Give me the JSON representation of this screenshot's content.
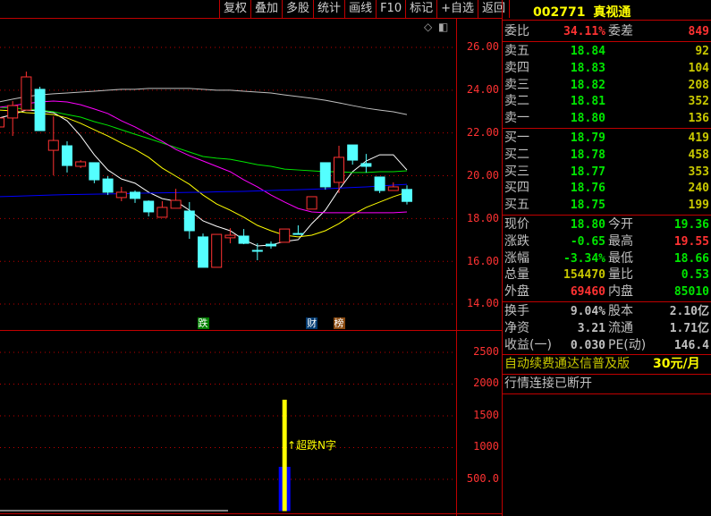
{
  "toolbar": {
    "buttons": [
      "复权",
      "叠加",
      "多股",
      "统计",
      "画线",
      "F10",
      "标记",
      "+自选",
      "返回"
    ]
  },
  "icons": {
    "diamond": "◇",
    "toggle": "◧"
  },
  "quote": {
    "code": "002771",
    "name": "真视通",
    "weibi": {
      "label": "委比",
      "value": "34.11%",
      "label2": "委差",
      "value2": "849",
      "color": "#ff3232",
      "color2": "#ff3232"
    },
    "asks": [
      {
        "label": "卖五",
        "price": "18.84",
        "vol": "92"
      },
      {
        "label": "卖四",
        "price": "18.83",
        "vol": "104"
      },
      {
        "label": "卖三",
        "price": "18.82",
        "vol": "208"
      },
      {
        "label": "卖二",
        "price": "18.81",
        "vol": "352"
      },
      {
        "label": "卖一",
        "price": "18.80",
        "vol": "136"
      }
    ],
    "bids": [
      {
        "label": "买一",
        "price": "18.79",
        "vol": "419"
      },
      {
        "label": "买二",
        "price": "18.78",
        "vol": "458"
      },
      {
        "label": "买三",
        "price": "18.77",
        "vol": "353"
      },
      {
        "label": "买四",
        "price": "18.76",
        "vol": "240"
      },
      {
        "label": "买五",
        "price": "18.75",
        "vol": "199"
      }
    ],
    "stats": [
      {
        "label": "现价",
        "value": "18.80",
        "color": "#00e600",
        "label2": "今开",
        "value2": "19.36",
        "color2": "#00e600"
      },
      {
        "label": "涨跌",
        "value": "-0.65",
        "color": "#00e600",
        "label2": "最高",
        "value2": "19.55",
        "color2": "#ff3232"
      },
      {
        "label": "涨幅",
        "value": "-3.34%",
        "color": "#00e600",
        "label2": "最低",
        "value2": "18.66",
        "color2": "#00e600"
      },
      {
        "label": "总量",
        "value": "154470",
        "color": "#c8c800",
        "label2": "量比",
        "value2": "0.53",
        "color2": "#00e600"
      },
      {
        "label": "外盘",
        "value": "69460",
        "color": "#ff3232",
        "label2": "内盘",
        "value2": "85010",
        "color2": "#00e600"
      }
    ],
    "fundamentals": [
      {
        "label": "换手",
        "value": "9.04%",
        "label2": "股本",
        "value2": "2.10亿"
      },
      {
        "label": "净资",
        "value": "3.21",
        "label2": "流通",
        "value2": "1.71亿"
      },
      {
        "label": "收益(一)",
        "value": "0.030",
        "label2": "PE(动)",
        "value2": "146.4"
      }
    ],
    "promo": "自动续费通达信普及版",
    "promo_price": "30元/月",
    "status": "行情连接已断开"
  },
  "colors": {
    "up": "#ff3232",
    "down": "#54ffff",
    "grid": "#c00000",
    "price_text": "#00e600",
    "vol_text": "#c8c800"
  },
  "chart_data": {
    "type": "candlestick",
    "price_axis": {
      "ticks": [
        "26.00",
        "24.00",
        "22.00",
        "20.00",
        "18.00",
        "16.00",
        "14.00"
      ],
      "range": [
        14,
        26
      ]
    },
    "ohlc": [
      [
        22.28,
        22.75,
        22.2,
        22.7
      ],
      [
        22.7,
        23.49,
        21.86,
        23.28
      ],
      [
        23.07,
        24.87,
        23.07,
        24.62
      ],
      [
        24.04,
        24.16,
        22.11,
        22.11
      ],
      [
        21.19,
        22.78,
        20.02,
        21.65
      ],
      [
        21.4,
        21.61,
        20.15,
        20.48
      ],
      [
        20.44,
        20.73,
        20.36,
        20.65
      ],
      [
        20.61,
        20.61,
        19.65,
        19.81
      ],
      [
        19.85,
        19.98,
        19.1,
        19.23
      ],
      [
        18.98,
        19.48,
        18.81,
        19.23
      ],
      [
        19.23,
        19.31,
        18.73,
        18.94
      ],
      [
        18.81,
        18.85,
        18.1,
        18.31
      ],
      [
        18.06,
        18.81,
        18.06,
        18.52
      ],
      [
        18.48,
        19.39,
        18.48,
        18.85
      ],
      [
        18.35,
        18.77,
        17.05,
        17.43
      ],
      [
        17.14,
        17.3,
        15.72,
        15.72
      ],
      [
        15.72,
        17.26,
        15.72,
        17.26
      ],
      [
        17.1,
        17.55,
        16.84,
        17.22
      ],
      [
        17.18,
        17.51,
        16.8,
        16.84
      ],
      [
        16.51,
        16.84,
        16.05,
        16.47
      ],
      [
        16.8,
        16.93,
        16.59,
        16.72
      ],
      [
        16.89,
        17.51,
        16.89,
        17.51
      ],
      [
        17.3,
        17.68,
        17.26,
        17.26
      ],
      [
        18.44,
        19.02,
        18.44,
        19.02
      ],
      [
        20.61,
        20.61,
        19.35,
        19.48
      ],
      [
        19.69,
        21.4,
        19.19,
        20.86
      ],
      [
        21.44,
        21.44,
        20.52,
        20.73
      ],
      [
        20.57,
        21.02,
        20.15,
        20.44
      ],
      [
        19.94,
        19.94,
        19.19,
        19.31
      ],
      [
        19.31,
        19.69,
        19.31,
        19.48
      ],
      [
        19.36,
        19.55,
        18.66,
        18.8
      ]
    ],
    "moving_averages": [
      {
        "color": "#ffffff",
        "values": [
          22.7,
          22.86,
          23.07,
          23.03,
          22.95,
          22.57,
          21.86,
          20.98,
          20.27,
          19.85,
          19.65,
          19.23,
          18.93,
          18.81,
          18.39,
          17.89,
          17.64,
          17.43,
          17.01,
          16.72,
          16.76,
          16.93,
          17.01,
          17.76,
          18.39,
          19.35,
          20.19,
          20.69,
          20.98,
          20.98,
          20.27
        ]
      },
      {
        "color": "#ffff00",
        "values": [
          23.07,
          23.03,
          22.95,
          22.91,
          22.86,
          22.7,
          22.45,
          22.15,
          21.86,
          21.53,
          21.23,
          20.86,
          20.36,
          19.98,
          19.6,
          19.1,
          18.68,
          18.39,
          18.06,
          17.68,
          17.43,
          17.22,
          17.14,
          17.22,
          17.43,
          17.76,
          18.18,
          18.52,
          18.77,
          19.02,
          19.23
        ]
      },
      {
        "color": "#00e600",
        "values": [
          23.2,
          23.16,
          23.12,
          23.07,
          22.99,
          22.86,
          22.74,
          22.53,
          22.36,
          22.15,
          21.94,
          21.74,
          21.53,
          21.32,
          21.11,
          20.9,
          20.82,
          20.77,
          20.65,
          20.52,
          20.44,
          20.31,
          20.27,
          20.23,
          20.19,
          20.19,
          20.15,
          20.15,
          20.19,
          20.19,
          20.23
        ]
      },
      {
        "color": "#ff00ff",
        "values": [
          23.2,
          23.28,
          23.37,
          23.45,
          23.49,
          23.45,
          23.32,
          23.12,
          22.91,
          22.57,
          22.28,
          21.94,
          21.61,
          21.23,
          20.94,
          20.69,
          20.44,
          20.19,
          19.81,
          19.48,
          19.1,
          18.77,
          18.47,
          18.31,
          18.27,
          18.27,
          18.27,
          18.27,
          18.27,
          18.27,
          18.31
        ]
      },
      {
        "color": "#c0c0c0",
        "values": [
          23.45,
          23.58,
          23.7,
          23.78,
          23.83,
          23.87,
          23.91,
          23.95,
          24.0,
          24.04,
          24.04,
          24.08,
          24.08,
          24.08,
          24.08,
          24.04,
          24.0,
          24.0,
          23.95,
          23.91,
          23.87,
          23.78,
          23.7,
          23.62,
          23.53,
          23.41,
          23.28,
          23.16,
          23.07,
          22.99,
          22.86
        ]
      },
      {
        "color": "#0000ff",
        "values": [
          19.02,
          19.04,
          19.06,
          19.08,
          19.1,
          19.12,
          19.13,
          19.14,
          19.15,
          19.16,
          19.18,
          19.19,
          19.2,
          19.21,
          19.22,
          19.23,
          19.25,
          19.26,
          19.27,
          19.29,
          19.31,
          19.33,
          19.35,
          19.37,
          19.39,
          19.42,
          19.45,
          19.48,
          19.52,
          19.56,
          19.6
        ]
      }
    ],
    "markers": [
      {
        "index": 15,
        "text": "跌",
        "bg": "#008000"
      },
      {
        "index": 23,
        "text": "财",
        "bg": "#003a70"
      },
      {
        "index": 25,
        "text": "榜",
        "bg": "#8a4a10"
      }
    ],
    "indicator": {
      "axis_ticks": [
        "2500",
        "2000",
        "1500",
        "1000",
        "500.0"
      ],
      "range": [
        0,
        2500
      ],
      "bars": [
        {
          "index": 21,
          "blue": 697,
          "yellow": 1754
        }
      ],
      "signal": {
        "index": 21,
        "text": "↑超跌N字"
      }
    }
  }
}
